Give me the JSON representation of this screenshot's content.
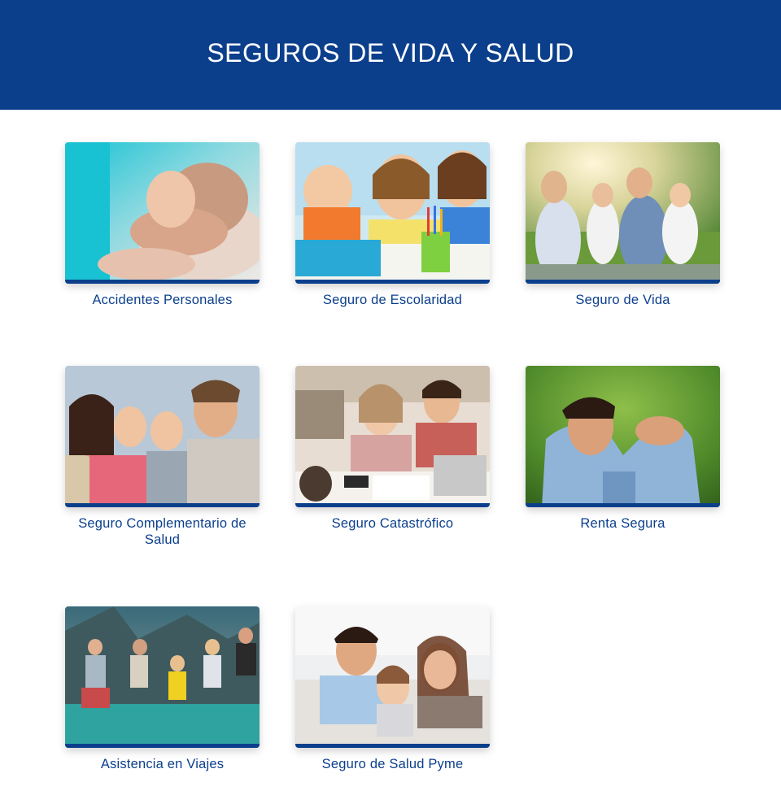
{
  "header": {
    "title": "SEGUROS DE VIDA Y SALUD"
  },
  "cards": [
    {
      "label": "Accidentes Personales",
      "image": "hands-stacked-photo"
    },
    {
      "label": "Seguro de Escolaridad",
      "image": "school-kids-photo"
    },
    {
      "label": "Seguro de Vida",
      "image": "family-park-photo"
    },
    {
      "label": "Seguro Complementario de Salud",
      "image": "family-smiling-photo"
    },
    {
      "label": "Seguro Catastrófico",
      "image": "couple-bills-photo"
    },
    {
      "label": "Renta Segura",
      "image": "relaxed-man-photo"
    },
    {
      "label": "Asistencia en Viajes",
      "image": "jumping-friends-photo"
    },
    {
      "label": "Seguro de Salud Pyme",
      "image": "family-home-photo"
    }
  ],
  "colors": {
    "brand_blue": "#0b3f8c",
    "background": "#ffffff"
  }
}
